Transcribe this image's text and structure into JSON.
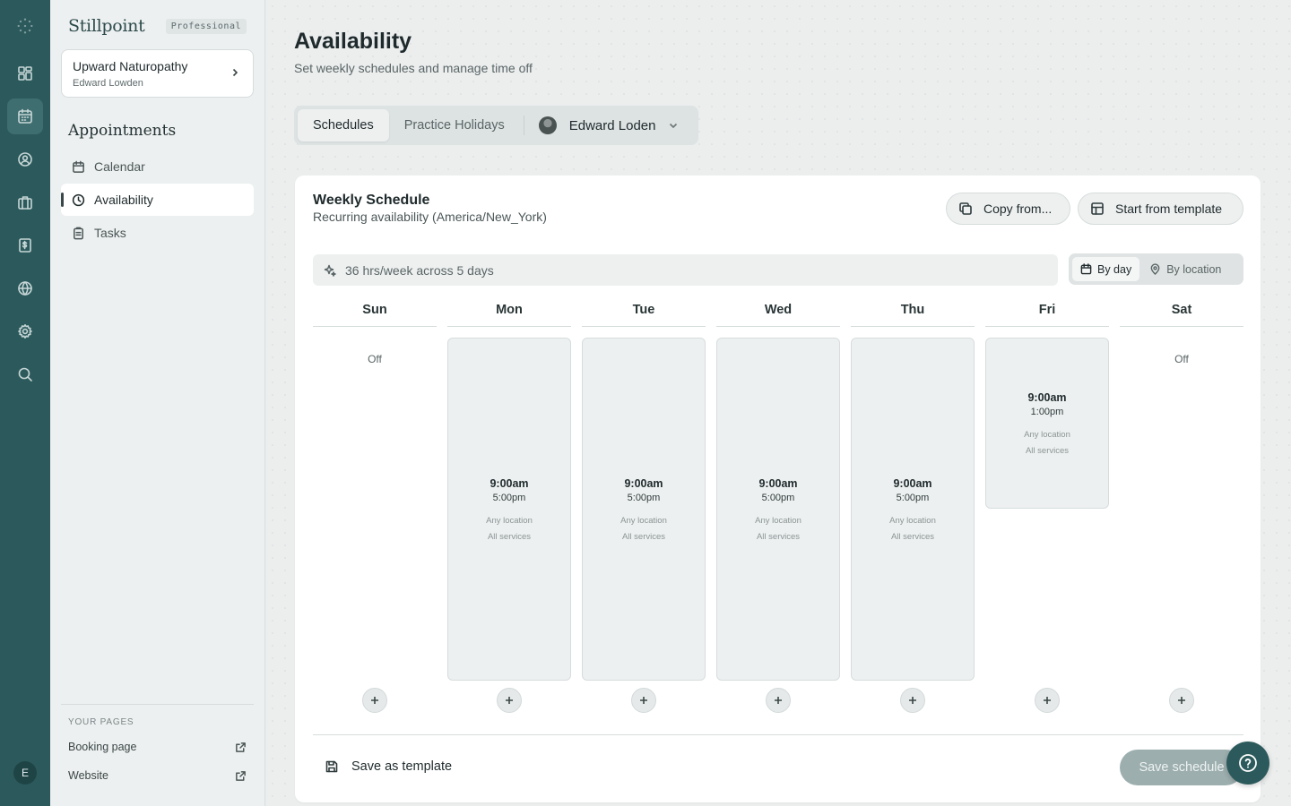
{
  "rail": {
    "items": [
      {
        "icon": "dashboard-icon"
      },
      {
        "icon": "calendar-icon",
        "active": true
      },
      {
        "icon": "user-circle-icon"
      },
      {
        "icon": "briefcase-icon"
      },
      {
        "icon": "invoice-icon"
      },
      {
        "icon": "globe-icon"
      },
      {
        "icon": "gear-icon"
      },
      {
        "icon": "search-icon"
      }
    ],
    "avatar_initial": "E",
    "accent": "#2c5a5c"
  },
  "sidebar": {
    "brand": "Stillpoint",
    "plan": "Professional",
    "practice": {
      "name": "Upward Naturopathy",
      "user": "Edward Lowden"
    },
    "section_title": "Appointments",
    "nav": [
      {
        "label": "Calendar",
        "icon": "calendar-icon"
      },
      {
        "label": "Availability",
        "icon": "clock-icon",
        "active": true
      },
      {
        "label": "Tasks",
        "icon": "clipboard-icon"
      }
    ],
    "pages_heading": "YOUR PAGES",
    "pages": [
      {
        "label": "Booking page",
        "icon": "external-link-icon"
      },
      {
        "label": "Website",
        "icon": "external-link-icon"
      }
    ]
  },
  "header": {
    "title": "Availability",
    "subtitle": "Set weekly schedules and manage time off"
  },
  "tabs": {
    "items": [
      {
        "label": "Schedules",
        "active": true
      },
      {
        "label": "Practice Holidays"
      }
    ],
    "practitioner": "Edward Loden"
  },
  "schedule": {
    "title": "Weekly Schedule",
    "subtitle": "Recurring availability (America/New_York)",
    "copy_label": "Copy from...",
    "template_label": "Start from template",
    "summary": "36 hrs/week across 5 days",
    "view_by_day": "By day",
    "view_by_location": "By location",
    "days": [
      {
        "name": "Sun",
        "off": "Off"
      },
      {
        "name": "Mon",
        "start": "9:00am",
        "end": "5:00pm",
        "location": "Any location",
        "services": "All services"
      },
      {
        "name": "Tue",
        "start": "9:00am",
        "end": "5:00pm",
        "location": "Any location",
        "services": "All services"
      },
      {
        "name": "Wed",
        "start": "9:00am",
        "end": "5:00pm",
        "location": "Any location",
        "services": "All services"
      },
      {
        "name": "Thu",
        "start": "9:00am",
        "end": "5:00pm",
        "location": "Any location",
        "services": "All services"
      },
      {
        "name": "Fri",
        "start": "9:00am",
        "end": "1:00pm",
        "location": "Any location",
        "services": "All services"
      },
      {
        "name": "Sat",
        "off": "Off"
      }
    ],
    "save_template_label": "Save as template",
    "save_schedule_label": "Save schedule"
  }
}
